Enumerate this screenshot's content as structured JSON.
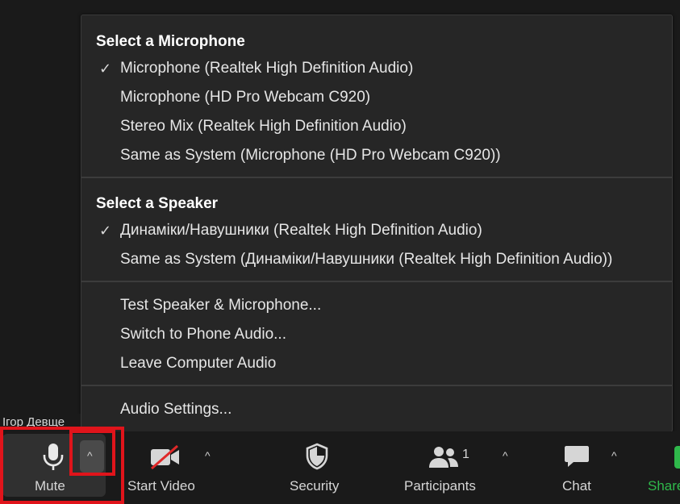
{
  "audio_menu": {
    "microphone": {
      "title": "Select a Microphone",
      "items": [
        {
          "label": "Microphone (Realtek High Definition Audio)",
          "selected": true
        },
        {
          "label": "Microphone (HD Pro Webcam C920)",
          "selected": false
        },
        {
          "label": "Stereo Mix (Realtek High Definition Audio)",
          "selected": false
        },
        {
          "label": "Same as System (Microphone (HD Pro Webcam C920))",
          "selected": false
        }
      ]
    },
    "speaker": {
      "title": "Select a Speaker",
      "items": [
        {
          "label": "Динаміки/Навушники (Realtek High Definition Audio)",
          "selected": true
        },
        {
          "label": "Same as System (Динаміки/Навушники (Realtek High Definition Audio))",
          "selected": false
        }
      ]
    },
    "actions": [
      {
        "label": "Test Speaker & Microphone..."
      },
      {
        "label": "Switch to Phone Audio..."
      },
      {
        "label": "Leave Computer Audio"
      }
    ],
    "settings": {
      "label": "Audio Settings..."
    },
    "check_glyph": "✓"
  },
  "participant_name": "Ігор Девще",
  "toolbar": {
    "mute": {
      "label": "Mute",
      "icon": "microphone-icon"
    },
    "video": {
      "label": "Start Video",
      "icon": "video-off-icon"
    },
    "security": {
      "label": "Security",
      "icon": "shield-icon"
    },
    "participants": {
      "label": "Participants",
      "count": "1",
      "icon": "participants-icon"
    },
    "chat": {
      "label": "Chat",
      "icon": "chat-icon"
    },
    "share": {
      "label": "Share",
      "icon": "share-icon"
    },
    "caret_glyph": "^"
  },
  "colors": {
    "highlight": "#e0141b",
    "share_green": "#2fb84b",
    "video_off_red": "#e02828"
  }
}
